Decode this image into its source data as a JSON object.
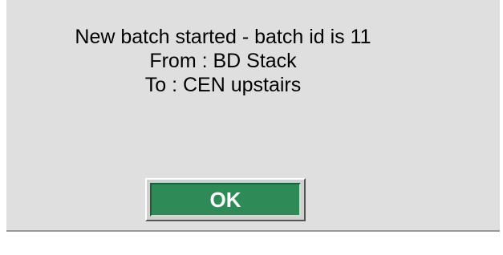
{
  "dialog": {
    "lines": [
      "New batch started - batch id is 11",
      "From : BD Stack",
      "To : CEN upstairs"
    ],
    "ok_label": "OK"
  },
  "colors": {
    "dialog_background": "#dfdfdf",
    "button_fill": "#2e8b57",
    "button_text": "#ffffff"
  }
}
